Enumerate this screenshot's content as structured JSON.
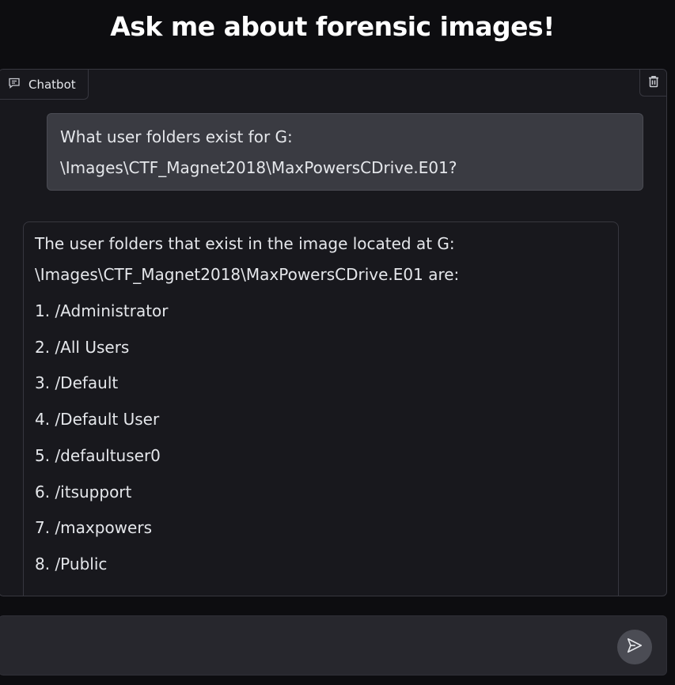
{
  "page": {
    "title": "Ask me about forensic images!"
  },
  "chatbot": {
    "label": "Chatbot",
    "icons": {
      "label_icon": "chat-bubble-icon",
      "clear_icon": "trash-icon"
    }
  },
  "messages": {
    "user": {
      "line1": "What user folders exist for G:",
      "line2": "\\Images\\CTF_Magnet2018\\MaxPowersCDrive.E01?"
    },
    "bot": {
      "line1": "The user folders that exist in the image located at G:",
      "line2": "\\Images\\CTF_Magnet2018\\MaxPowersCDrive.E01 are:",
      "items": [
        "1. /Administrator",
        "2. /All Users",
        "3. /Default",
        "4. /Default User",
        "5. /defaultuser0",
        "6. /itsupport",
        "7. /maxpowers",
        "8. /Public"
      ]
    }
  },
  "input": {
    "value": "",
    "placeholder": "",
    "send_icon": "send-icon"
  },
  "colors": {
    "background": "#0d0d10",
    "panel": "#18181d",
    "user_bubble": "#3a3b42",
    "input_bar": "#27272d",
    "send_button": "#4b4c54"
  }
}
